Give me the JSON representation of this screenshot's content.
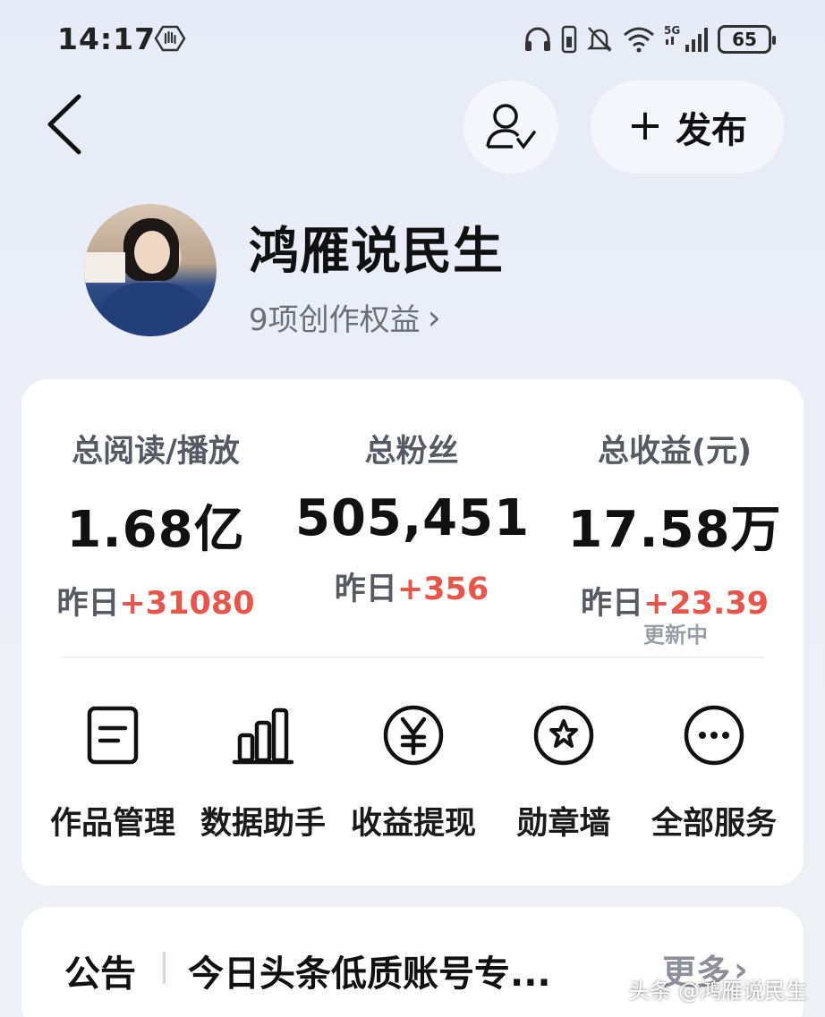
{
  "status_bar": {
    "time": "14:17",
    "battery": "65",
    "network": "5G",
    "icons": [
      "hand-icon",
      "headphones-icon",
      "vibrate-icon",
      "mute-icon",
      "wifi-icon",
      "signal-icon",
      "battery-icon"
    ]
  },
  "header": {
    "back_icon": "chevron-left-icon",
    "follow_icon": "user-check-icon",
    "publish_label": "发布",
    "publish_plus": "+"
  },
  "profile": {
    "name": "鸿雁说民生",
    "rights_text": "9项创作权益",
    "rights_chevron": "›"
  },
  "stats": [
    {
      "label": "总阅读/播放",
      "value": "1.68亿",
      "delta_prefix": "昨日",
      "delta": "+31080"
    },
    {
      "label": "总粉丝",
      "value": "505,451",
      "delta_prefix": "昨日",
      "delta": "+356"
    },
    {
      "label": "总收益(元)",
      "value": "17.58万",
      "delta_prefix": "昨日",
      "delta": "+23.39"
    }
  ],
  "updating_text": "更新中",
  "services": [
    {
      "label": "作品管理",
      "icon": "document-icon"
    },
    {
      "label": "数据助手",
      "icon": "bar-chart-icon"
    },
    {
      "label": "收益提现",
      "icon": "yen-icon"
    },
    {
      "label": "勋章墙",
      "icon": "medal-icon"
    },
    {
      "label": "全部服务",
      "icon": "more-icon"
    }
  ],
  "notice": {
    "title": "公告",
    "text": "今日头条低质账号专...",
    "more": "更多",
    "more_chevron": "›"
  },
  "watermark": "头条 @鸿雁说民生",
  "colors": {
    "accent_red": "#e9544b",
    "background": "#e6ebf7",
    "card": "#ffffff"
  }
}
